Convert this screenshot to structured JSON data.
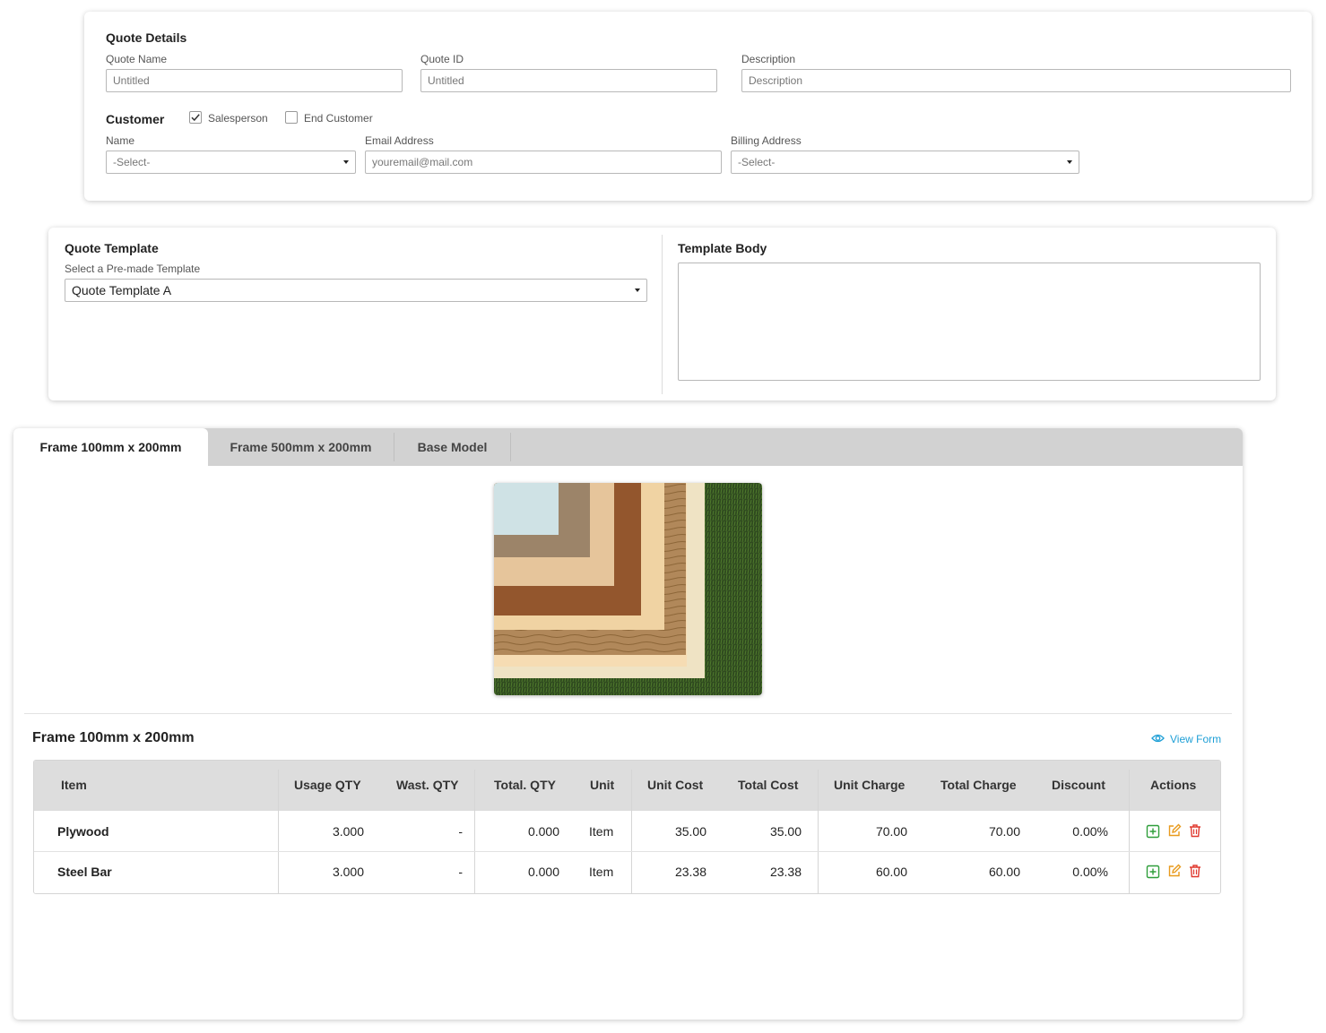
{
  "quote_details": {
    "title": "Quote Details",
    "quote_name": {
      "label": "Quote Name",
      "value": "Untitled"
    },
    "quote_id": {
      "label": "Quote ID",
      "value": "Untitled"
    },
    "description": {
      "label": "Description",
      "placeholder": "Description"
    },
    "customer": {
      "title": "Customer",
      "salesperson": {
        "label": "Salesperson",
        "checked": true
      },
      "end_customer": {
        "label": "End Customer",
        "checked": false
      },
      "name": {
        "label": "Name",
        "value": "-Select-"
      },
      "email": {
        "label": "Email Address",
        "placeholder": "youremail@mail.com"
      },
      "billing": {
        "label": "Billing Address",
        "value": "-Select-"
      }
    }
  },
  "quote_template": {
    "title": "Quote Template",
    "select_label": "Select a Pre-made Template",
    "selected": "Quote Template A",
    "body_title": "Template Body"
  },
  "items_panel": {
    "tabs": [
      {
        "label": "Frame 100mm x 200mm",
        "active": true
      },
      {
        "label": "Frame 500mm x 200mm",
        "active": false
      },
      {
        "label": "Base Model",
        "active": false
      }
    ],
    "section_title": "Frame 100mm x 200mm",
    "view_form": "View Form",
    "table": {
      "headers": [
        "Item",
        "Usage QTY",
        "Wast. QTY",
        "Total. QTY",
        "Unit",
        "Unit Cost",
        "Total Cost",
        "Unit Charge",
        "Total Charge",
        "Discount",
        "Actions"
      ],
      "rows": [
        {
          "item": "Plywood",
          "usage_qty": "3.000",
          "wast_qty": "-",
          "total_qty": "0.000",
          "unit": "Item",
          "unit_cost": "35.00",
          "total_cost": "35.00",
          "unit_charge": "70.00",
          "total_charge": "70.00",
          "discount": "0.00%"
        },
        {
          "item": "Steel Bar",
          "usage_qty": "3.000",
          "wast_qty": "-",
          "total_qty": "0.000",
          "unit": "Item",
          "unit_cost": "23.38",
          "total_cost": "23.38",
          "unit_charge": "60.00",
          "total_charge": "60.00",
          "discount": "0.00%"
        }
      ]
    }
  },
  "colors": {
    "add_icon": "#2e9e3a",
    "edit_icon": "#e89a1c",
    "delete_icon": "#e0392f",
    "link": "#1e9fd6"
  },
  "icons": [
    "checkmark-icon",
    "dropdown-arrow-icon",
    "eye-icon",
    "add-icon",
    "edit-icon",
    "delete-icon"
  ]
}
